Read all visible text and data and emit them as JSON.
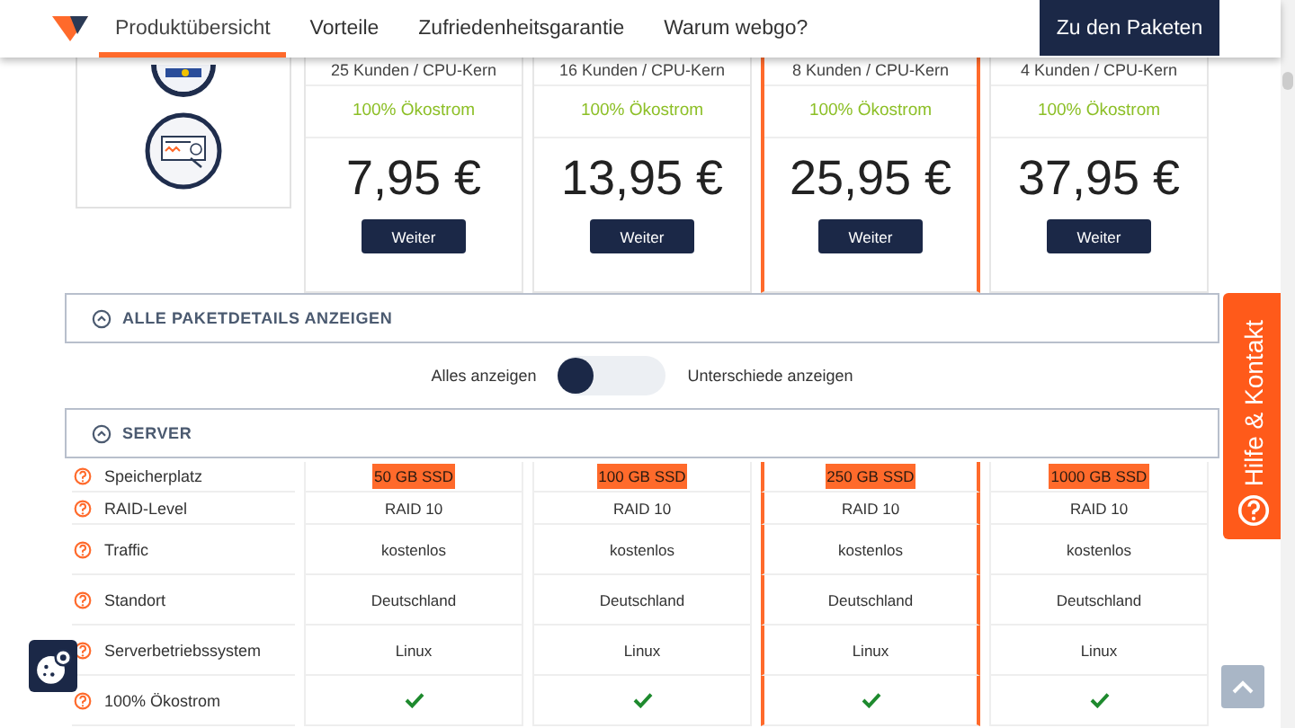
{
  "nav": {
    "items": [
      {
        "label": "Produktübersicht",
        "selected": true
      },
      {
        "label": "Vorteile",
        "selected": false
      },
      {
        "label": "Zufriedenheitsgarantie",
        "selected": false
      },
      {
        "label": "Warum webgo?",
        "selected": false
      }
    ],
    "cta": "Zu den Paketen"
  },
  "plans": [
    {
      "customers": "25 Kunden / CPU-Kern",
      "eco": "100% Ökostrom",
      "price": "7,95 €",
      "button": "Weiter",
      "highlighted": false
    },
    {
      "customers": "16 Kunden / CPU-Kern",
      "eco": "100% Ökostrom",
      "price": "13,95 €",
      "button": "Weiter",
      "highlighted": false
    },
    {
      "customers": "8 Kunden / CPU-Kern",
      "eco": "100% Ökostrom",
      "price": "25,95 €",
      "button": "Weiter",
      "highlighted": true
    },
    {
      "customers": "4 Kunden / CPU-Kern",
      "eco": "100% Ökostrom",
      "price": "37,95 €",
      "button": "Weiter",
      "highlighted": false
    }
  ],
  "details_bar": {
    "label": "ALLE PAKETDETAILS ANZEIGEN"
  },
  "view_switch": {
    "left": "Alles anzeigen",
    "right": "Unterschiede anzeigen",
    "on": false
  },
  "section": {
    "title": "SERVER"
  },
  "features": [
    {
      "label": "Speicherplatz",
      "kind": "badge",
      "values": [
        "50 GB SSD",
        "100 GB SSD",
        "250 GB SSD",
        "1000 GB SSD"
      ]
    },
    {
      "label": "RAID-Level",
      "kind": "text",
      "values": [
        "RAID 10",
        "RAID 10",
        "RAID 10",
        "RAID 10"
      ]
    },
    {
      "label": "Traffic",
      "kind": "text",
      "values": [
        "kostenlos",
        "kostenlos",
        "kostenlos",
        "kostenlos"
      ]
    },
    {
      "label": "Standort",
      "kind": "text",
      "values": [
        "Deutschland",
        "Deutschland",
        "Deutschland",
        "Deutschland"
      ]
    },
    {
      "label": "Serverbetriebssystem",
      "kind": "text",
      "values": [
        "Linux",
        "Linux",
        "Linux",
        "Linux"
      ]
    },
    {
      "label": "100% Ökostrom",
      "kind": "check",
      "values": [
        true,
        true,
        true,
        true
      ]
    }
  ],
  "help_tab": "Hilfe & Kontakt"
}
